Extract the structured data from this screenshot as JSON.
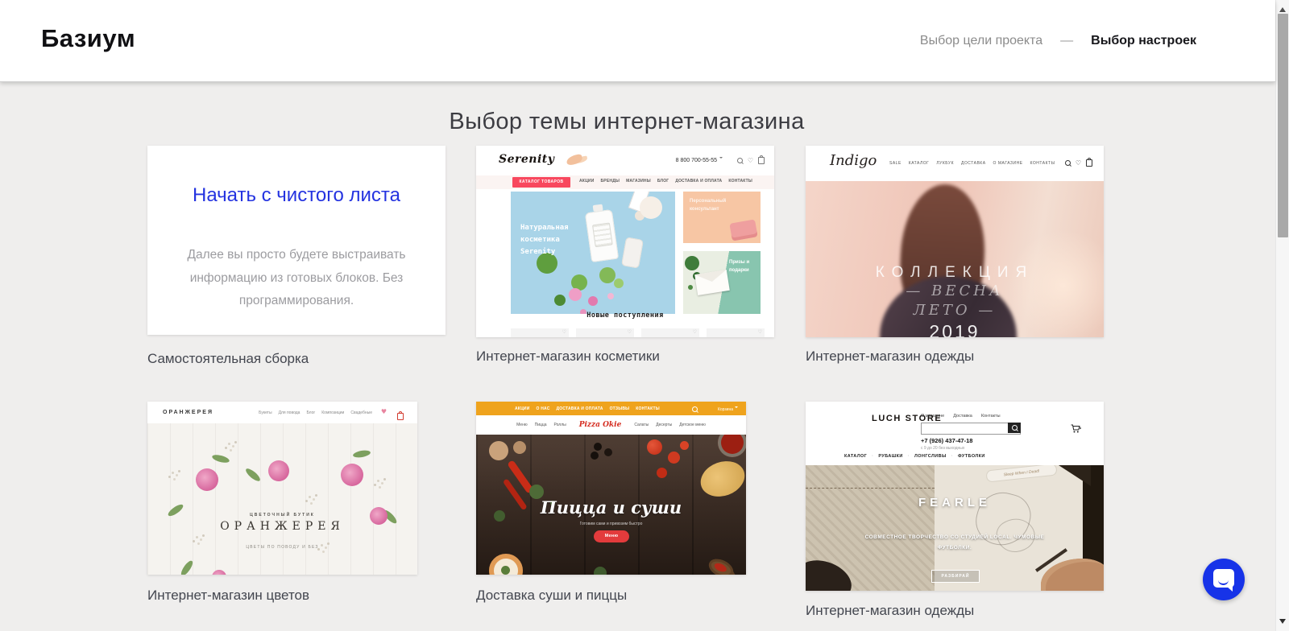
{
  "header": {
    "logo": "Базиум",
    "step_previous": "Выбор цели проекта",
    "step_separator": "—",
    "step_current": "Выбор настроек"
  },
  "page": {
    "title": "Выбор темы интернет-магазина"
  },
  "cards": {
    "blank": {
      "heading": "Начать с чистого листа",
      "body": "Далее вы просто будете выстраивать информацию из готовых блоков. Без программирования.",
      "caption": "Самостоятельная сборка"
    },
    "serenity": {
      "caption": "Интернет-магазин косметики",
      "logo": "Serenity",
      "phone": "8 800 700-55-55",
      "catalog_button": "КАТАЛОГ ТОВАРОВ",
      "nav": [
        "АКЦИИ",
        "БРЕНДЫ",
        "МАГАЗИНЫ",
        "БЛОГ",
        "ДОСТАВКА И ОПЛАТА",
        "КОНТАКТЫ"
      ],
      "banner_main": "Натуральная косметика Serenity",
      "banner_consult": "Персональный консультант",
      "banner_prizes": "Призы и подарки",
      "section_title": "Новые поступления"
    },
    "indigo": {
      "caption": "Интернет-магазин одежды",
      "logo": "Indigo",
      "nav": [
        "SALE",
        "КАТАЛОГ",
        "ЛУКБУК",
        "ДОСТАВКА",
        "О МАГАЗИНЕ",
        "КОНТАКТЫ"
      ],
      "hero": {
        "line1": "КОЛЛЕКЦИЯ",
        "line2": "— ВЕСНА",
        "line3": "ЛЕТО —",
        "line4": "2019"
      }
    },
    "orangery": {
      "caption": "Интернет-магазин цветов",
      "logo": "ОРАНЖЕРЕЯ",
      "nav": [
        "Букеты",
        "Для повода",
        "Блог",
        "Композиции",
        "Свадебные"
      ],
      "hero": {
        "tagline_top": "ЦВЕТОЧНЫЙ БУТИК",
        "title": "ОРАНЖЕРЕЯ",
        "tagline_bottom": "ЦВЕТЫ ПО ПОВОДУ И БЕЗ"
      }
    },
    "pizza": {
      "caption": "Доставка суши и пиццы",
      "topnav": [
        "АКЦИИ",
        "О НАС",
        "ДОСТАВКА И ОПЛАТА",
        "ОТЗЫВЫ",
        "КОНТАКТЫ"
      ],
      "cart_label": "Корзина",
      "nav_left": [
        "Меню",
        "Пицца",
        "Роллы"
      ],
      "logo": "Pizza Okie",
      "nav_right": [
        "Салаты",
        "Десерты",
        "Детское меню"
      ],
      "hero": {
        "title": "Пицца и суши",
        "subtitle": "Готовим сами и привозим быстро",
        "button": "Меню"
      }
    },
    "luch": {
      "caption": "Интернет-магазин одежды",
      "logo": "LUCH STORE",
      "toplinks": [
        "О магазине",
        "Доставка",
        "Контакты"
      ],
      "phone": "+7 (926) 437-47-18",
      "hours": "с 9 до 20 без выходных",
      "nav": [
        "КАТАЛОГ",
        "РУБАШКИ",
        "ЛОНГСЛИВЫ",
        "ФУТБОЛКИ"
      ],
      "hero": {
        "title": "FEARLE",
        "subtitle": "СОВМЕСТНОЕ ТВОРЧЕСТВО СО СТУДИЕЙ LOCAL. ЧУМОВЫЕ ФУТБОЛКИ.",
        "button": "РАЗБИРАЙ",
        "pen_note": "Sleep When I Dead!"
      }
    }
  },
  "colors": {
    "blank_heading_blue": "#2433e0",
    "chat_blue": "#1733e8",
    "serenity_red": "#f8485e",
    "pizza_orange": "#efa31d",
    "pizza_red": "#e33b3c"
  }
}
